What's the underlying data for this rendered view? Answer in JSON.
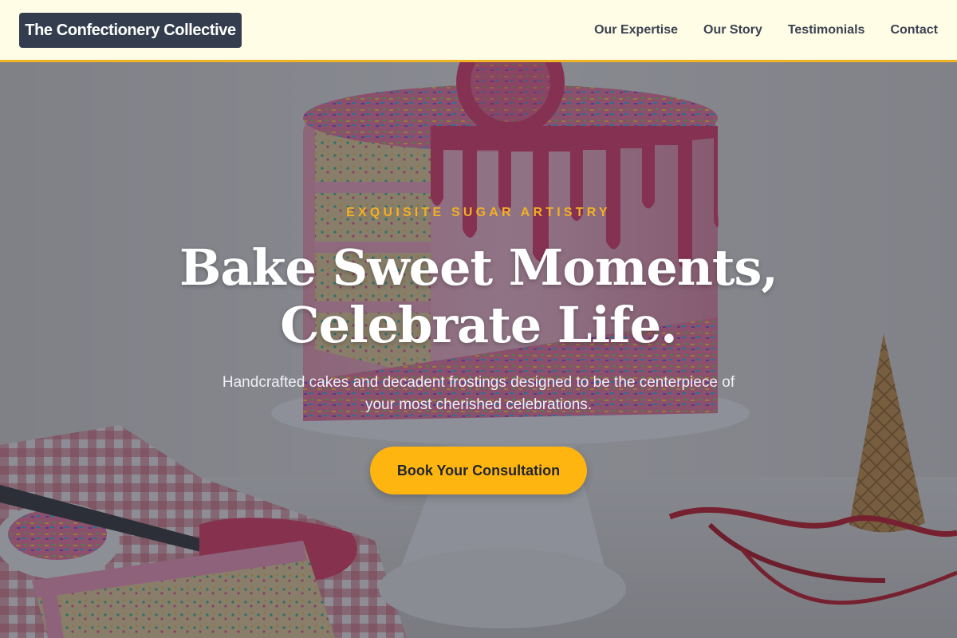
{
  "header": {
    "logo_text": "The Confectionery Collective",
    "nav": [
      {
        "label": "Our Expertise"
      },
      {
        "label": "Our Story"
      },
      {
        "label": "Testimonials"
      },
      {
        "label": "Contact"
      }
    ]
  },
  "hero": {
    "eyebrow": "EXQUISITE SUGAR ARTISTRY",
    "headline_line1": "Bake Sweet Moments,",
    "headline_line2": "Celebrate Life.",
    "subtitle": "Handcrafted cakes and decadent frostings designed to be the centerpiece of your most cherished celebrations.",
    "cta_label": "Book Your Consultation"
  },
  "colors": {
    "header_bg": "#fffde6",
    "accent": "#ffb50f",
    "logo_bg": "#333d4d"
  }
}
